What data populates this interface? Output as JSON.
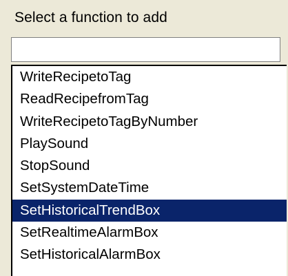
{
  "dialog": {
    "heading": "Select a function to add",
    "search": {
      "value": "",
      "placeholder": ""
    },
    "functions": [
      {
        "label": "WriteRecipetoTag",
        "selected": false
      },
      {
        "label": "ReadRecipefromTag",
        "selected": false
      },
      {
        "label": "WriteRecipetoTagByNumber",
        "selected": false
      },
      {
        "label": "PlaySound",
        "selected": false
      },
      {
        "label": "StopSound",
        "selected": false
      },
      {
        "label": "SetSystemDateTime",
        "selected": false
      },
      {
        "label": "SetHistoricalTrendBox",
        "selected": true
      },
      {
        "label": "SetRealtimeAlarmBox",
        "selected": false
      },
      {
        "label": "SetHistoricalAlarmBox",
        "selected": false
      }
    ],
    "colors": {
      "selection_background": "#0a246a",
      "selection_text": "#ffffff",
      "dialog_background": "#ece9d8"
    }
  }
}
